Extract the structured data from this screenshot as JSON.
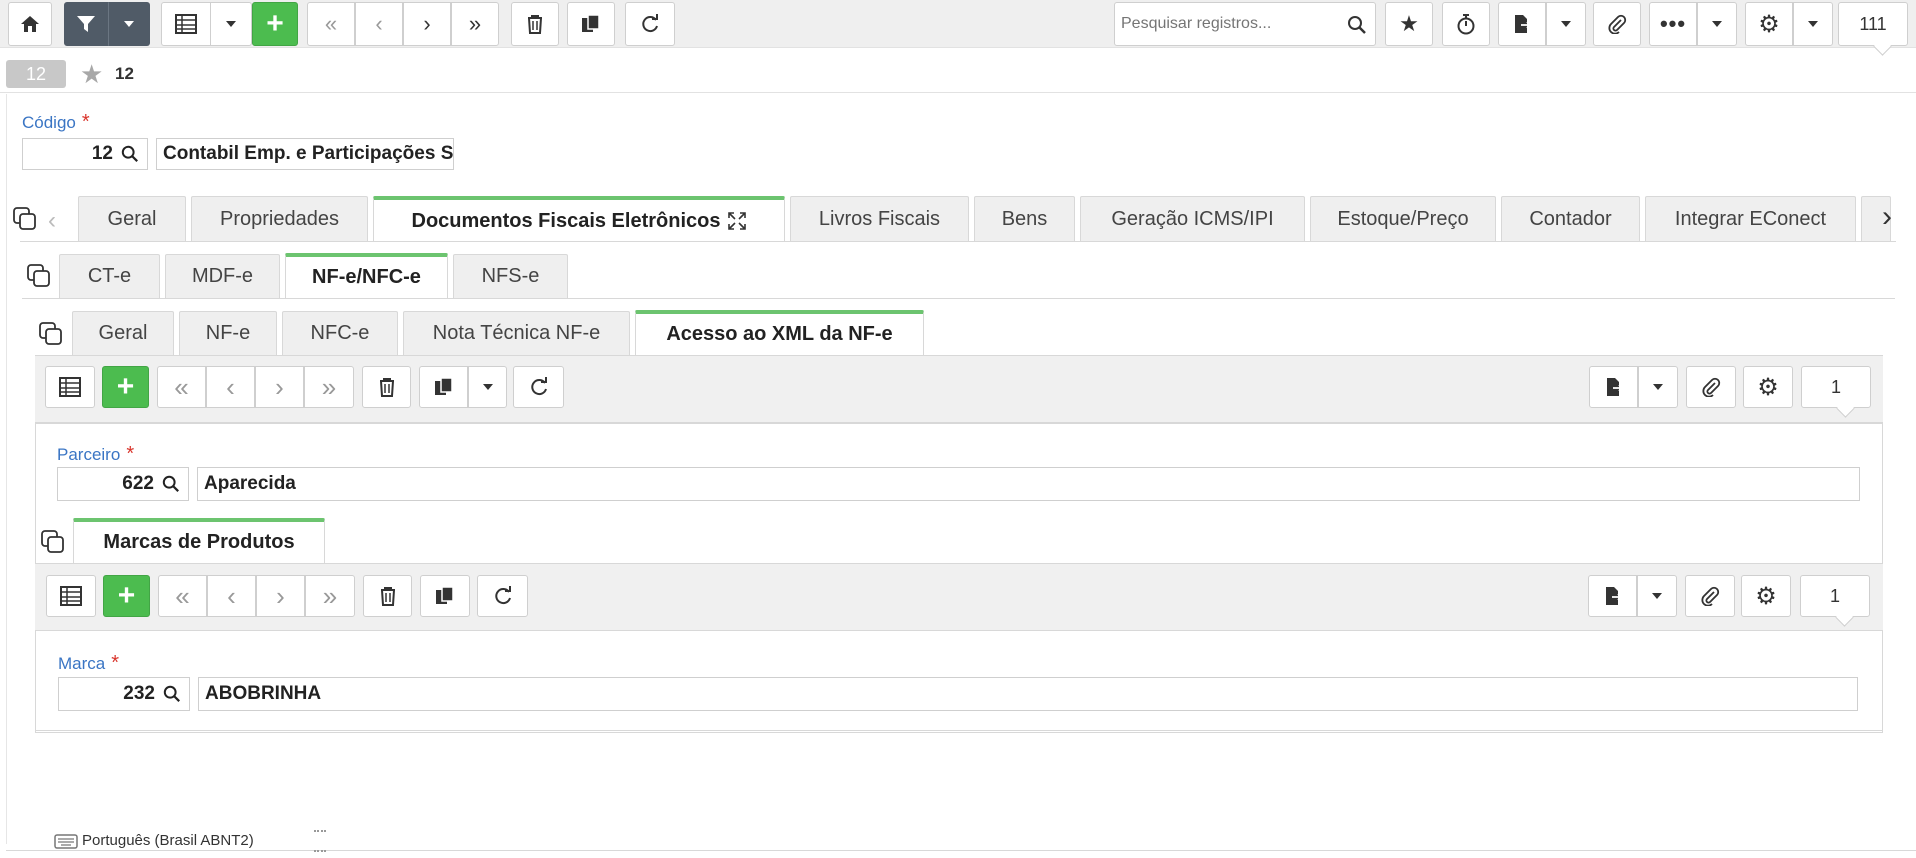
{
  "toolbar": {
    "search_placeholder": "Pesquisar registros...",
    "record_count": "111"
  },
  "record": {
    "badge": "12",
    "favorite_label": "12"
  },
  "form": {
    "codigo_label": "Código",
    "codigo_value": "12",
    "codigo_desc": "Contabil Emp. e Participações S",
    "required_mark": "*"
  },
  "main_tabs": [
    {
      "label": "Geral"
    },
    {
      "label": "Propriedades"
    },
    {
      "label": "Documentos Fiscais Eletrônicos",
      "active": true
    },
    {
      "label": "Livros Fiscais"
    },
    {
      "label": "Bens"
    },
    {
      "label": "Geração ICMS/IPI"
    },
    {
      "label": "Estoque/Preço"
    },
    {
      "label": "Contador"
    },
    {
      "label": "Integrar EConect"
    }
  ],
  "doc_tabs": [
    {
      "label": "CT-e"
    },
    {
      "label": "MDF-e"
    },
    {
      "label": "NF-e/NFC-e",
      "active": true
    },
    {
      "label": "NFS-e"
    }
  ],
  "nfe_tabs": [
    {
      "label": "Geral"
    },
    {
      "label": "NF-e"
    },
    {
      "label": "NFC-e"
    },
    {
      "label": "Nota Técnica NF-e"
    },
    {
      "label": "Acesso ao XML da NF-e",
      "active": true
    }
  ],
  "xml_access": {
    "counter": "1",
    "parceiro_label": "Parceiro",
    "parceiro_code": "622",
    "parceiro_name": "Aparecida"
  },
  "marcas_tab": {
    "label": "Marcas de Produtos"
  },
  "marcas": {
    "counter": "1",
    "marca_label": "Marca",
    "marca_code": "232",
    "marca_name": "ABOBRINHA"
  },
  "statusbar": {
    "keyboard": "Português (Brasil ABNT2)"
  },
  "colors": {
    "accent_green": "#4cbc4f",
    "active_tab_border": "#6cc46f",
    "label_blue": "#3a75c4",
    "required_red": "#d9342b",
    "dark_button": "#505b67"
  }
}
